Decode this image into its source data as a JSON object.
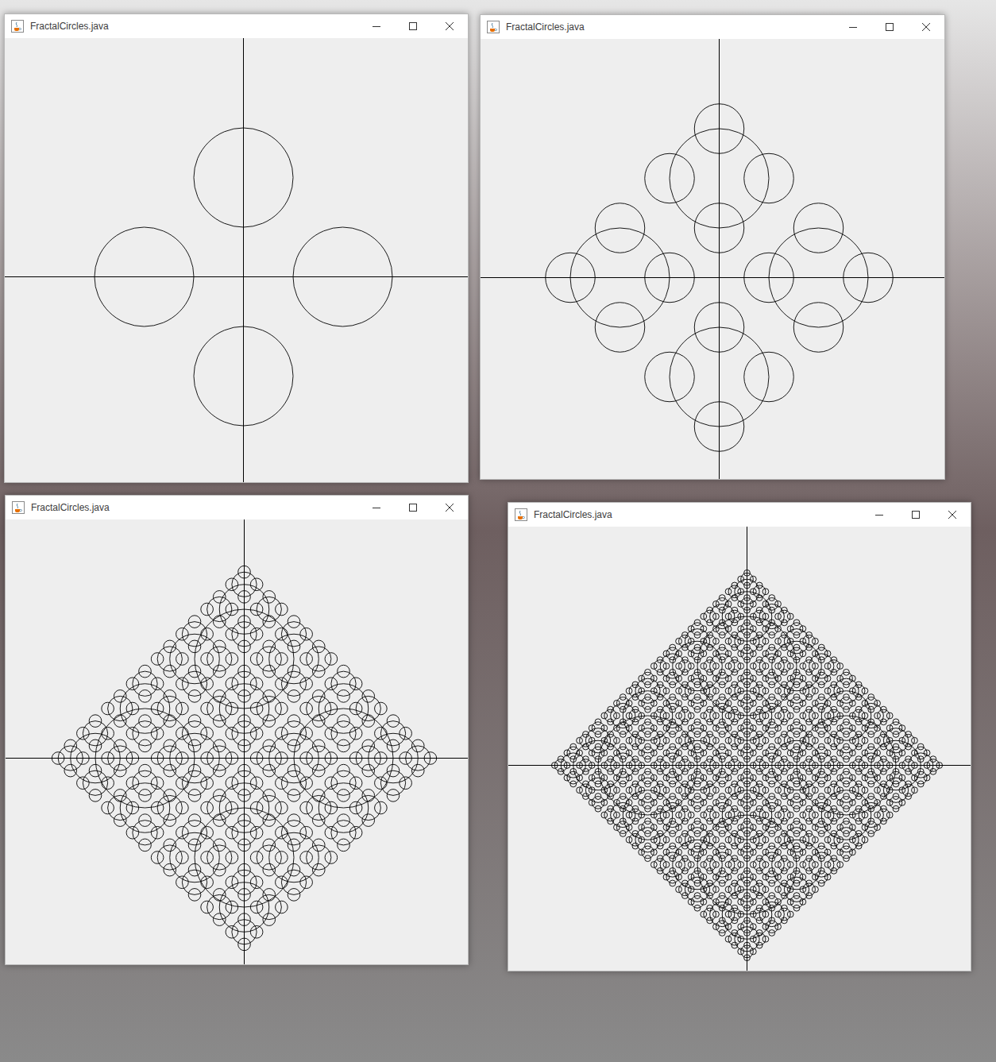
{
  "windows": [
    {
      "title": "FractalCircles.java",
      "depth": 1
    },
    {
      "title": "FractalCircles.java",
      "depth": 2
    },
    {
      "title": "FractalCircles.java",
      "depth": 4
    },
    {
      "title": "FractalCircles.java",
      "depth": 5
    }
  ]
}
